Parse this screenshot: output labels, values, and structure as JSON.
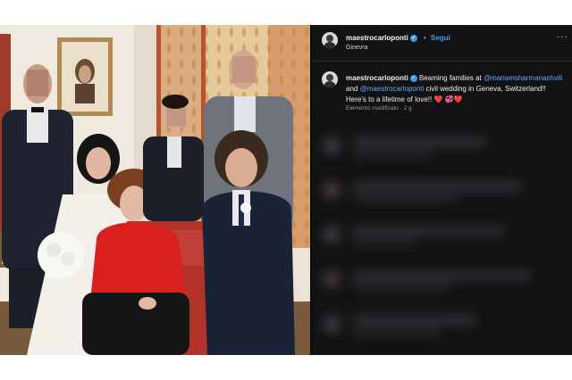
{
  "post": {
    "username": "maestrocarloponti",
    "follow_label": "Segui",
    "separator": "•",
    "location": "Ginevra",
    "more_label": "···",
    "caption": {
      "username": "maestrocarloponti",
      "text_1": " Beaming families at ",
      "mention_1": "@mariamsharmanashvili",
      "text_2": " and ",
      "mention_2": "@maestrocarloponti",
      "text_3": " civil wedding in Geneva, Switzerland!! Here's to a lifetime of love!! ",
      "emoji": "❤️ 💞❤️"
    },
    "meta": "Elemento modificato · 2 g"
  },
  "colors": {
    "panel_bg": "#121214",
    "accent_blue": "#3897f0",
    "mention": "#6aa8f7"
  }
}
